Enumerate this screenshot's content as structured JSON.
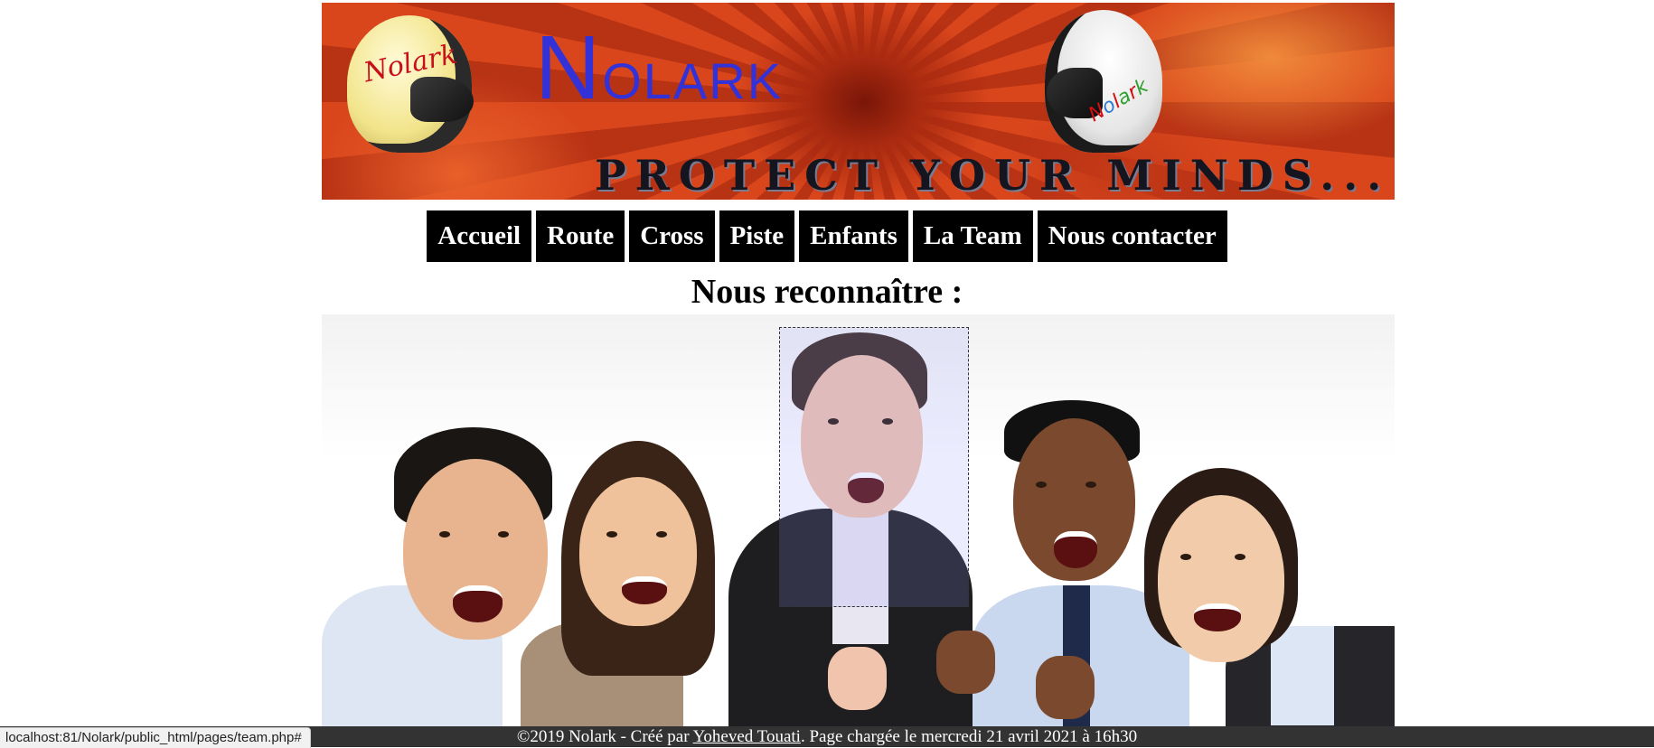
{
  "banner": {
    "logo_first": "N",
    "logo_rest": "OLARK",
    "slogan": "PROTECT YOUR MINDS...",
    "helmet_left_text": "Nolark",
    "helmet_right_text": "Nolark"
  },
  "nav": {
    "items": [
      "Accueil",
      "Route",
      "Cross",
      "Piste",
      "Enfants",
      "La Team",
      "Nous contacter"
    ]
  },
  "main": {
    "title": "Nous reconnaître :"
  },
  "footer": {
    "prefix": "©2019 Nolark - Créé par ",
    "author": "Yoheved Touati",
    "suffix": ". Page chargée le mercredi 21 avril 2021 à 16h30"
  },
  "status_bar": {
    "url": "localhost:81/Nolark/public_html/pages/team.php#"
  },
  "colors": {
    "nav_bg": "#000000",
    "footer_bg": "#333333",
    "logo": "#3232d8"
  }
}
